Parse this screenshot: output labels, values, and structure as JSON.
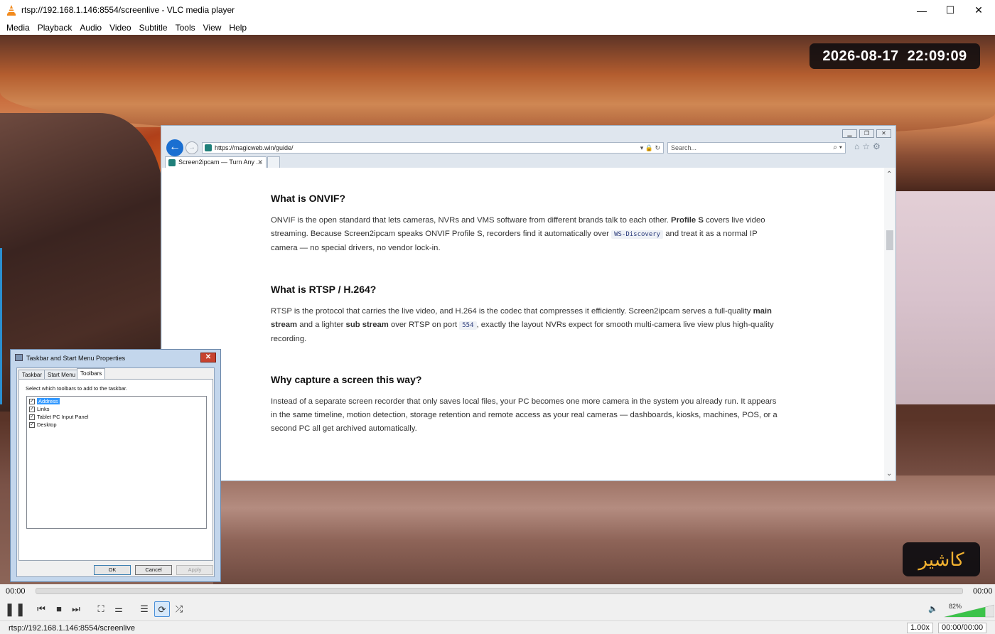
{
  "window": {
    "title": "rtsp://192.168.1.146:8554/screenlive - VLC media player"
  },
  "menu": [
    "Media",
    "Playback",
    "Audio",
    "Video",
    "Subtitle",
    "Tools",
    "View",
    "Help"
  ],
  "overlay": {
    "date": "2026-08-17",
    "time": "22:09:09",
    "badge": "كاشير"
  },
  "browser": {
    "url": "https://magicweb.win/guide/",
    "search_placeholder": "Search...",
    "tab_title": "Screen2ipcam — Turn Any ...",
    "sections": [
      {
        "heading": "What is ONVIF?",
        "p1": "ONVIF is the open standard that lets cameras, NVRs and VMS software from different brands talk to each other. ",
        "b1": "Profile S",
        "p2": " covers live video streaming. Because Screen2ipcam speaks ONVIF Profile S, recorders find it automatically over ",
        "code": "WS-Discovery",
        "p3": " and treat it as a normal IP camera — no special drivers, no vendor lock-in."
      },
      {
        "heading": "What is RTSP / H.264?",
        "p1": "RTSP is the protocol that carries the live video, and H.264 is the codec that compresses it efficiently. Screen2ipcam serves a full-quality ",
        "b1": "main stream",
        "p2": " and a lighter ",
        "b2": "sub stream",
        "p3": " over RTSP on port ",
        "code": "554",
        "p4": ", exactly the layout NVRs expect for smooth multi-camera live view plus high-quality recording."
      },
      {
        "heading": "Why capture a screen this way?",
        "p1": "Instead of a separate screen recorder that only saves local files, your PC becomes one more camera in the system you already run. It appears in the same timeline, motion detection, storage retention and remote access as your real cameras — dashboards, kiosks, machines, POS, or a second PC all get archived automatically."
      }
    ]
  },
  "dialog": {
    "title": "Taskbar and Start Menu Properties",
    "tabs": [
      "Taskbar",
      "Start Menu",
      "Toolbars"
    ],
    "hint": "Select which toolbars to add to the taskbar.",
    "items": [
      {
        "label": "Address",
        "checked": true
      },
      {
        "label": "Links",
        "checked": true
      },
      {
        "label": "Tablet PC Input Panel",
        "checked": true
      },
      {
        "label": "Desktop",
        "checked": true
      }
    ],
    "ok": "OK",
    "cancel": "Cancel",
    "apply": "Apply"
  },
  "player": {
    "elapsed": "00:00",
    "total": "00:00",
    "volume": "82%",
    "volume_level": 0.82,
    "status_url": "rtsp://192.168.1.146:8554/screenlive",
    "speed": "1.00x",
    "time_box": "00:00/00:00"
  }
}
